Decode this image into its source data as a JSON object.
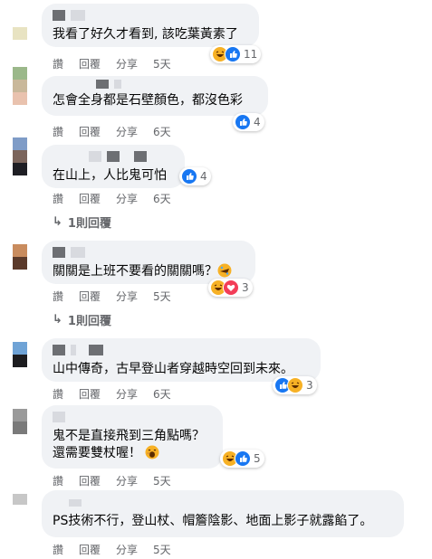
{
  "comments": [
    {
      "text": "我看了好久才看到, 該吃葉黃素了",
      "reactions": [
        "haha",
        "like"
      ],
      "count": "11",
      "actions": [
        "讚",
        "回覆",
        "分享"
      ],
      "time": "5天"
    },
    {
      "text": "怎會全身都是石壁顏色，都沒色彩",
      "reactions": [
        "like"
      ],
      "count": "4",
      "actions": [
        "讚",
        "回覆",
        "分享"
      ],
      "time": "6天"
    },
    {
      "text": "在山上，人比鬼可怕",
      "reactions": [
        "like"
      ],
      "count": "4",
      "actions": [
        "讚",
        "回覆",
        "分享"
      ],
      "time": "6天",
      "replies": "1則回覆"
    },
    {
      "text": "關關是上班不要看的關關嗎？",
      "emoji": "rofl",
      "reactions": [
        "haha",
        "love"
      ],
      "count": "3",
      "actions": [
        "讚",
        "回覆",
        "分享"
      ],
      "time": "5天",
      "replies": "1則回覆"
    },
    {
      "text": "山中傳奇，古早登山者穿越時空回到未來。",
      "reactions": [
        "like",
        "haha"
      ],
      "count": "3",
      "actions": [
        "讚",
        "回覆",
        "分享"
      ],
      "time": "6天"
    },
    {
      "text": "鬼不是直接飛到三角點嗎？\n還需要雙杖喔！",
      "emoji": "yawn",
      "reactions": [
        "haha",
        "like"
      ],
      "count": "5",
      "actions": [
        "讚",
        "回覆",
        "分享"
      ],
      "time": "5天"
    },
    {
      "text": "PS技術不行，登山杖、帽簷陰影、地面上影子就露餡了。",
      "reactions": [],
      "count": "",
      "actions": [
        "讚",
        "回覆",
        "分享"
      ],
      "time": "5天"
    }
  ],
  "colors": {
    "bubble": "#f0f2f5",
    "meta": "#65676b",
    "like": "#1877f2",
    "love": "#f33e58",
    "haha": "#f7b125"
  }
}
